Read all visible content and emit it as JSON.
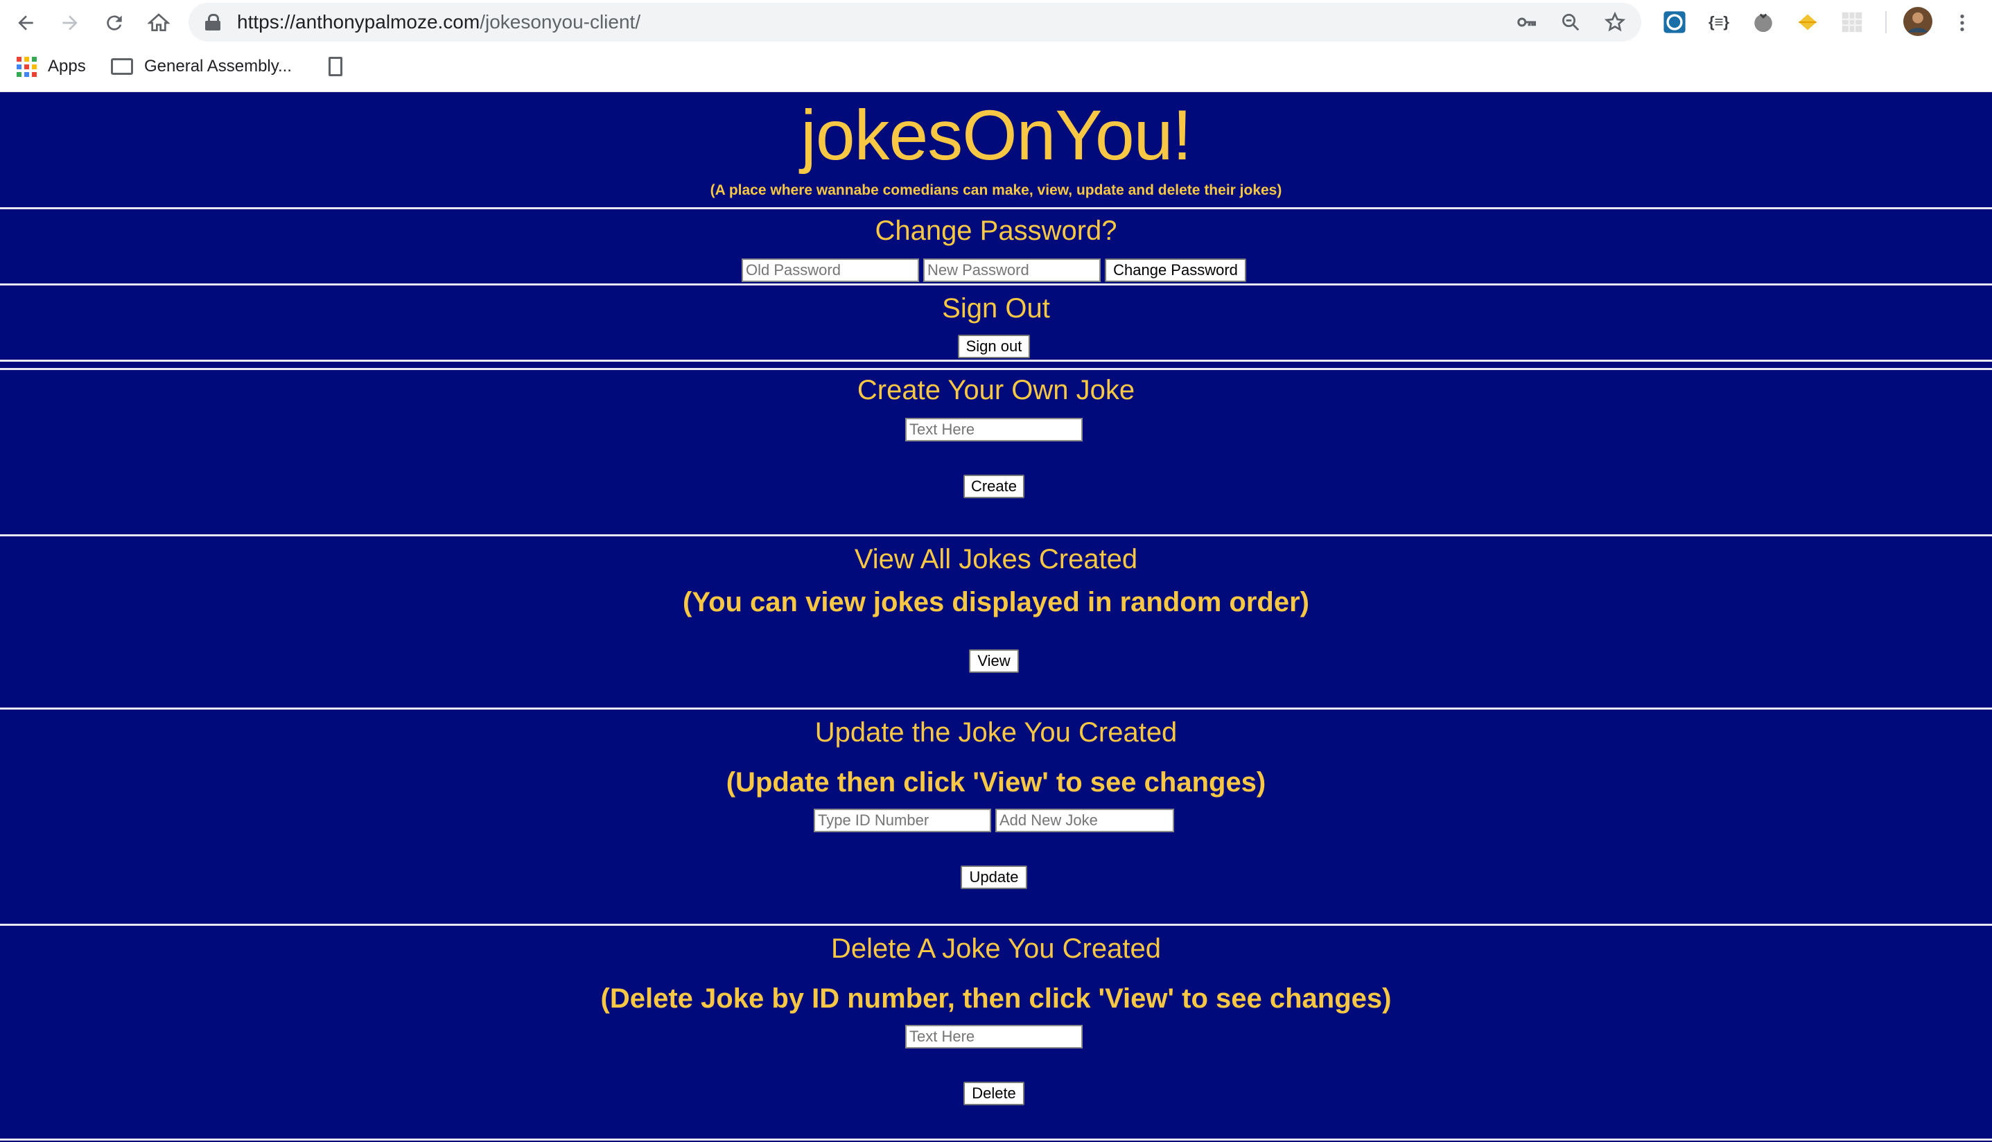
{
  "browser": {
    "url_domain": "https://anthonypalmoze.com",
    "url_path": "/jokesonyou-client/",
    "bookmarks": {
      "apps_label": "Apps",
      "folder_label": "General Assembly..."
    },
    "icons": {
      "back": "arrow-left-icon",
      "forward": "arrow-right-icon",
      "reload": "reload-icon",
      "home": "home-icon",
      "lock": "lock-icon",
      "key": "key-icon",
      "zoom": "zoom-icon",
      "star": "star-icon",
      "menu": "more-vertical-icon"
    },
    "ext_json_label": "{≡}"
  },
  "colors": {
    "page_background": "#000a7a",
    "accent_text": "#f8c744"
  },
  "header": {
    "title": "jokesOnYou!",
    "subtitle": "(A place where wannabe comedians can make, view, update and delete their jokes)"
  },
  "change_password": {
    "heading": "Change Password?",
    "old_placeholder": "Old Password",
    "new_placeholder": "New Password",
    "button": "Change Password"
  },
  "sign_out": {
    "heading": "Sign Out",
    "button": "Sign out"
  },
  "create": {
    "heading": "Create Your Own Joke",
    "placeholder": "Text Here",
    "button": "Create"
  },
  "view": {
    "heading": "View All Jokes Created",
    "subheading": "(You can view jokes displayed in random order)",
    "button": "View"
  },
  "update": {
    "heading": "Update the Joke You Created",
    "subheading": "(Update then click 'View' to see changes)",
    "id_placeholder": "Type ID Number",
    "joke_placeholder": "Add New Joke",
    "button": "Update"
  },
  "delete": {
    "heading": "Delete A Joke You Created",
    "subheading": "(Delete Joke by ID number, then click 'View' to see changes)",
    "placeholder": "Text Here",
    "button": "Delete"
  }
}
